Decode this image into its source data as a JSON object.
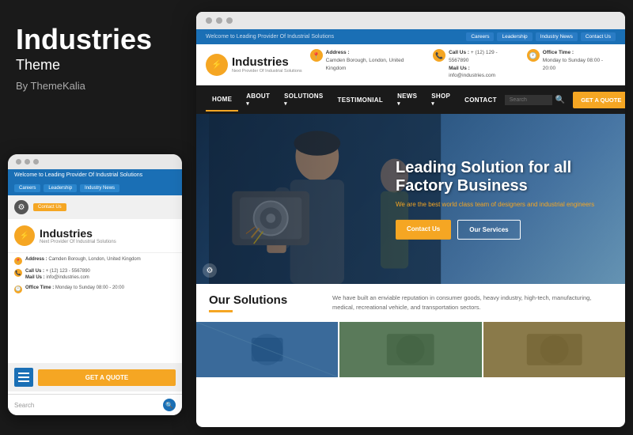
{
  "left": {
    "title": "Industries",
    "subtitle": "Theme",
    "author": "By ThemeKalia"
  },
  "mobile": {
    "topbar_text": "Welcome to Leading Provider Of Industrial Solutions",
    "nav_buttons": [
      "Careers",
      "Leadership",
      "Industry News"
    ],
    "contact_us_btn": "Contact Us",
    "logo_name": "Industries",
    "logo_tagline": "Next Provider Of Industrial Solutions",
    "logo_icon": "⚡",
    "address_label": "Address :",
    "address_value": "Camden Borough, London, United Kingdom",
    "call_label": "Call Us :",
    "call_value": "+ (12) 123 - 5567890",
    "mail_label": "Mail Us :",
    "mail_value": "info@industries.com",
    "office_label": "Office Time :",
    "office_value": "Monday to Sunday 08:00 - 20:00",
    "quote_btn": "GET A QUOTE",
    "search_placeholder": "Search"
  },
  "desktop": {
    "topbar_text": "Welcome to Leading Provider Of Industrial Solutions",
    "topbar_buttons": [
      "Careers",
      "Leadership",
      "Industry News",
      "Contact Us"
    ],
    "logo_name": "Industries",
    "logo_tagline": "Next Provider Of Industrial Solutions",
    "logo_icon": "⚡",
    "address_label": "Address :",
    "address_value": "Camden Borough, London, United Kingdom",
    "call_label": "Call Us :",
    "call_value": "+ (12) 129 - 5567890",
    "mail_label": "Mail Us :",
    "mail_value": "info@industries.com",
    "office_label": "Office Time :",
    "office_value": "Monday to Sunday 08:00 - 20:00",
    "nav_items": [
      "HOME",
      "ABOUT",
      "SOLUTIONS",
      "TESTIMONIAL",
      "NEWS",
      "SHOP",
      "CONTACT"
    ],
    "nav_dropdowns": [
      "ABOUT",
      "SOLUTIONS",
      "NEWS",
      "SHOP"
    ],
    "search_placeholder": "Search",
    "quote_btn": "GET A QUOTE",
    "hero_title": "Leading Solution for all Factory Business",
    "hero_subtitle": "We are the best world class team of designers and industrial engineers",
    "hero_btn1": "Contact Us",
    "hero_btn2": "Our Services",
    "solutions_title": "Our Solutions",
    "solutions_text": "We have built an enviable reputation in consumer goods, heavy industry, high-tech, manufacturing, medical, recreational vehicle, and transportation sectors."
  }
}
